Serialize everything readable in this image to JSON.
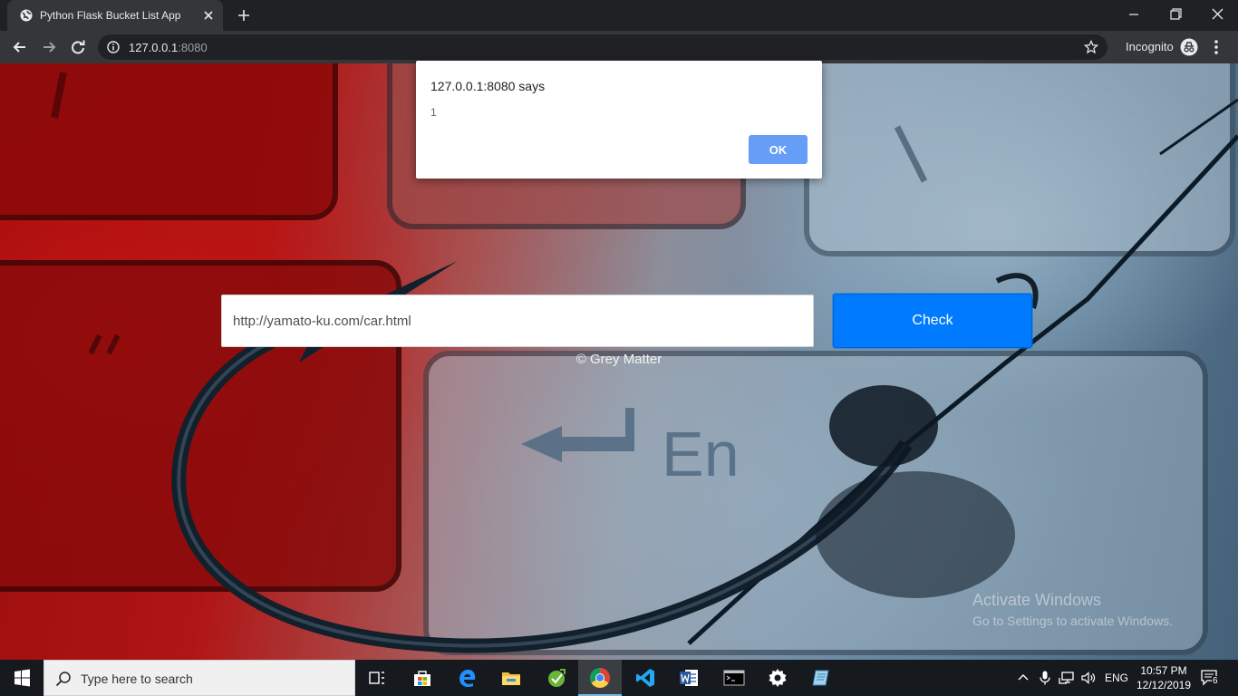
{
  "browser": {
    "tab_title": "Python Flask Bucket List App",
    "url_host": "127.0.0.1",
    "url_port": ":8080",
    "incognito_label": "Incognito"
  },
  "page": {
    "url_input_value": "http://yamato-ku.com/car.html",
    "check_label": "Check",
    "footer": "© Grey Matter"
  },
  "alert": {
    "origin": "127.0.0.1:8080 says",
    "message": "1",
    "ok_label": "OK"
  },
  "watermark": {
    "line1": "Activate Windows",
    "line2": "Go to Settings to activate Windows."
  },
  "taskbar": {
    "search_placeholder": "Type here to search",
    "language": "ENG",
    "time": "10:57 PM",
    "date": "12/12/2019",
    "notification_count": "6",
    "apps": [
      "task-view",
      "store",
      "edge",
      "file-explorer",
      "greenshot",
      "chrome",
      "vscode",
      "word",
      "terminal",
      "settings",
      "notepad"
    ]
  },
  "colors": {
    "primary_button": "#007bff",
    "alert_ok": "#669df6",
    "chrome_dark": "#202124"
  }
}
